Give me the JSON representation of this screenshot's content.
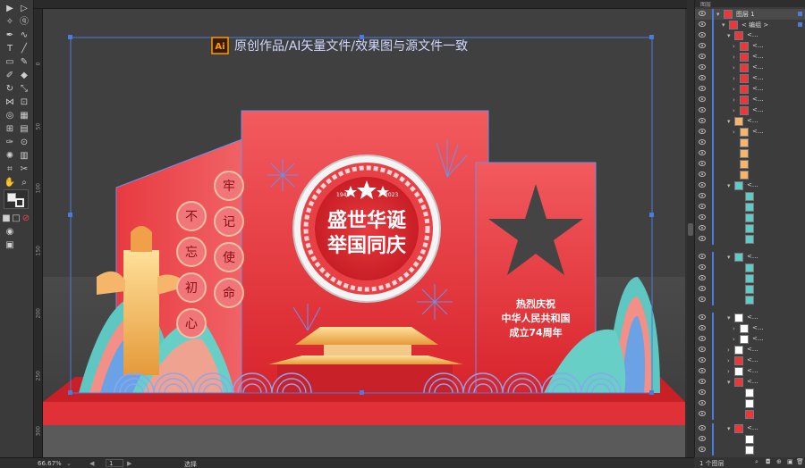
{
  "canvas": {
    "banner_badge": "Ai",
    "banner_text": "原创作品/AI矢量文件/效果图与源文件一致",
    "left_panel_chars": [
      "牢",
      "记",
      "使",
      "命",
      "不",
      "忘",
      "初",
      "心"
    ],
    "years_left": "1949",
    "years_right": "2023",
    "title_line1": "盛世华诞",
    "title_line2": "举国同庆",
    "right_text_line1": "热烈庆祝",
    "right_text_line2": "中华人民共和国",
    "right_text_line3": "成立74周年"
  },
  "rulers": {
    "left_labels": [
      "0",
      "50",
      "100",
      "150",
      "200",
      "250",
      "300"
    ]
  },
  "status": {
    "zoom": "66.67%",
    "artboard": "1",
    "tool_name": "选择"
  },
  "layers": {
    "top_tab": "图层",
    "layer1": "图层 1",
    "group": "< 编组 >",
    "item": "<...",
    "count_text": "1 个图层"
  },
  "colors": {
    "stage_red": "#e8373d",
    "gold": "#f5c66a",
    "teal": "#63c9c4",
    "blue_outline": "#4b7bdc",
    "bg": "#404040"
  }
}
